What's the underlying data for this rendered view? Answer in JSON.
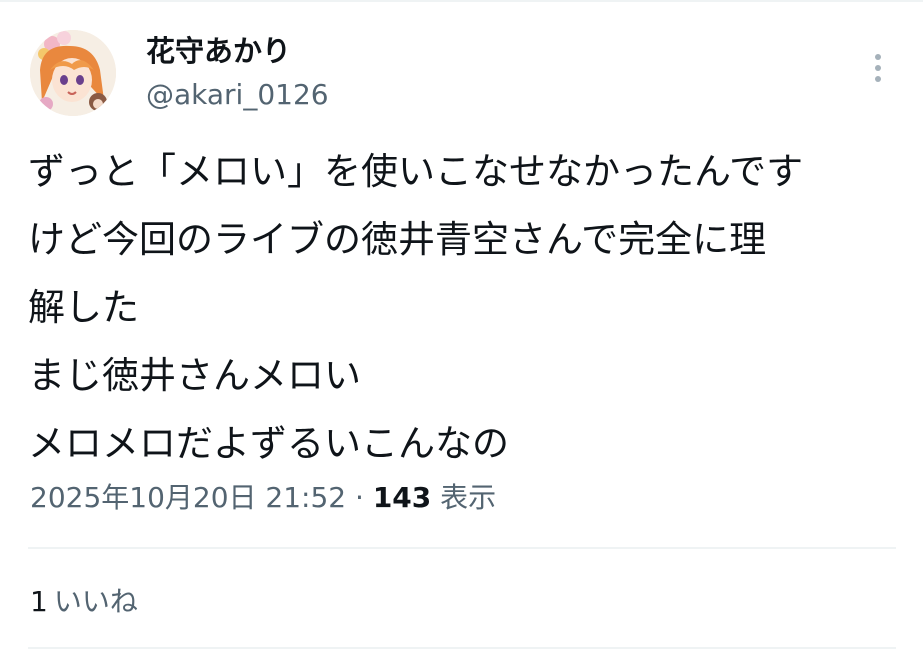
{
  "user": {
    "display_name": "花守あかり",
    "handle": "@akari_0126"
  },
  "tweet": {
    "lines": [
      "ずっと「メロい」を使いこなせなかったんです",
      "けど今回のライブの徳井青空さんで完全に理",
      "解した",
      "まじ徳井さんメロい",
      "メロメロだよずるいこんなの"
    ],
    "timestamp": "2025年10月20日 21:52",
    "separator": " · ",
    "views_count": "143",
    "views_label": " 表示"
  },
  "engagement": {
    "likes_count": "1",
    "likes_label": "いいね"
  },
  "icons": {
    "more": "more-vertical-icon"
  },
  "colors": {
    "text": "#0f1419",
    "secondary": "#536471",
    "divider": "#eff3f4",
    "dots": "#a5b1ba"
  }
}
